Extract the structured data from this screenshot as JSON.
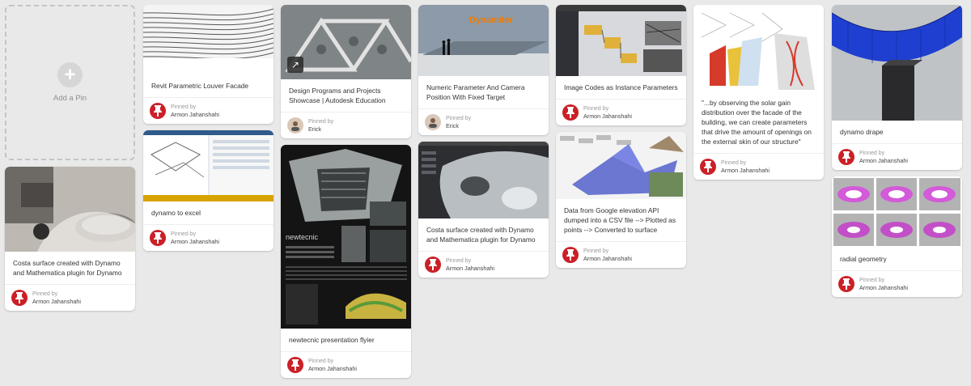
{
  "add_pin": {
    "label": "Add a Pin",
    "icon": "plus-icon"
  },
  "pins": {
    "c1p1": {
      "description": "Costa surface created with Dynamo and Mathematica plugin for Dynamo",
      "pinned_by": "Pinned by",
      "pinner": "Armon Jahanshahi"
    },
    "c2p1": {
      "description": "Revit Parametric Louver Facade",
      "pinned_by": "Pinned by",
      "pinner": "Armon Jahanshahi"
    },
    "c2p2": {
      "description": "dynamo to excel",
      "pinned_by": "Pinned by",
      "pinner": "Armon Jahanshahi"
    },
    "c3p1": {
      "description": "Design Programs and Projects Showcase | Autodesk Education",
      "pinned_by": "Pinned by",
      "pinner": "Erick"
    },
    "c3p2": {
      "description": "newtecnic presentation flyier",
      "pinned_by": "Pinned by",
      "pinner": "Armon Jahanshahi"
    },
    "c4p1": {
      "description": "Numeric Parameter And Camera Position With Fixed Target",
      "pinned_by": "Pinned by",
      "pinner": "Erick"
    },
    "c4p2": {
      "description": "Costa surface created with Dynamo and Mathematica plugin for Dynamo",
      "pinned_by": "Pinned by",
      "pinner": "Armon Jahanshahi"
    },
    "c5p1": {
      "description": "Image Codes as Instance Parameters",
      "pinned_by": "Pinned by",
      "pinner": "Armon Jahanshahi"
    },
    "c5p2": {
      "description": "Data from Google elevation API dumped into a CSV file --> Plotted as points --> Converted to surface",
      "pinned_by": "Pinned by",
      "pinner": "Armon Jahanshahi"
    },
    "c6p1": {
      "description": "\"...by observing the solar gain distribution over the facade of the building, we can create parameters that drive the amount of openings on the external skin of our structure\"",
      "pinned_by": "Pinned by",
      "pinner": "Armon Jahanshahi"
    },
    "c7p1": {
      "description": "dynamo drape",
      "pinned_by": "Pinned by",
      "pinner": "Armon Jahanshahi"
    },
    "c7p2": {
      "description": "radial geometry",
      "pinned_by": "Pinned by",
      "pinner": "Armon Jahanshahi"
    }
  },
  "image_text": {
    "dynamiter_sign": "Dynamiter",
    "newtecnic": "newtecnic"
  },
  "colors": {
    "pin_red": "#cb2027",
    "background": "#e9e9e9"
  }
}
